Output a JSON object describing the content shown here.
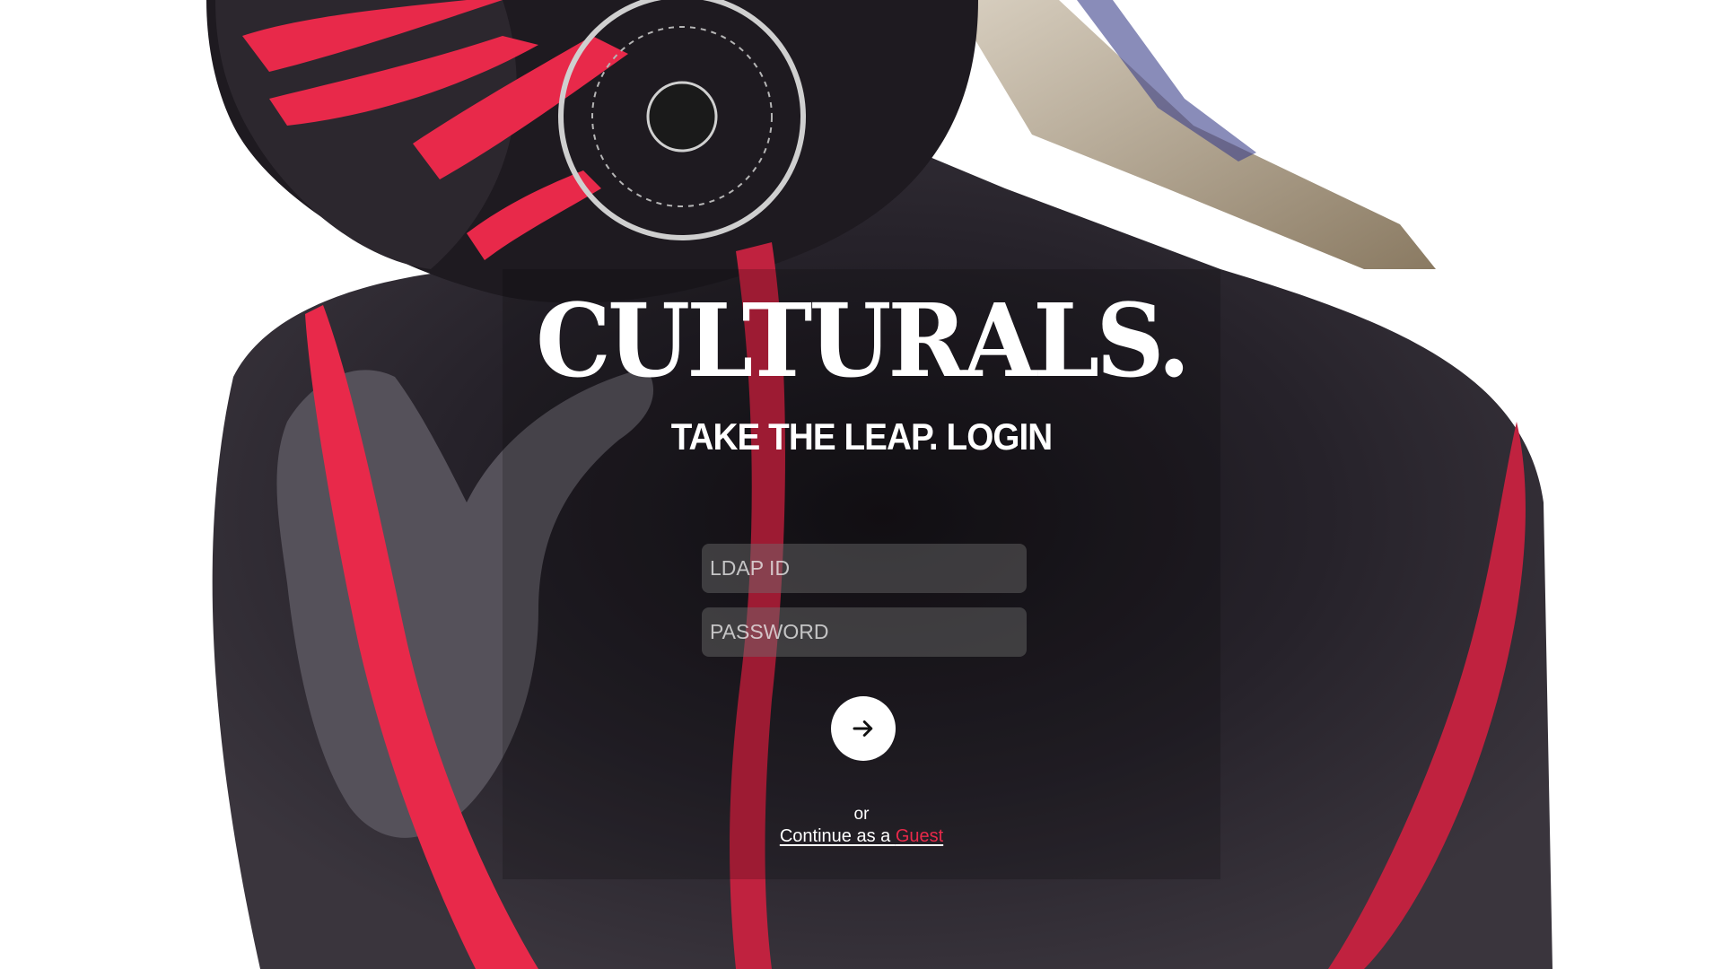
{
  "brand": {
    "logo_text": "CULTURALS.",
    "tagline": "TAKE THE LEAP. LOGIN"
  },
  "form": {
    "ldap_placeholder": "LDAP ID",
    "password_placeholder": "PASSWORD",
    "submit_icon": "arrow-right-icon"
  },
  "guest": {
    "separator": "or",
    "link_prefix": "Continue as a ",
    "link_accent": "Guest"
  },
  "colors": {
    "accent": "#e8294a",
    "text": "#ffffff",
    "background": "#ffffff"
  }
}
